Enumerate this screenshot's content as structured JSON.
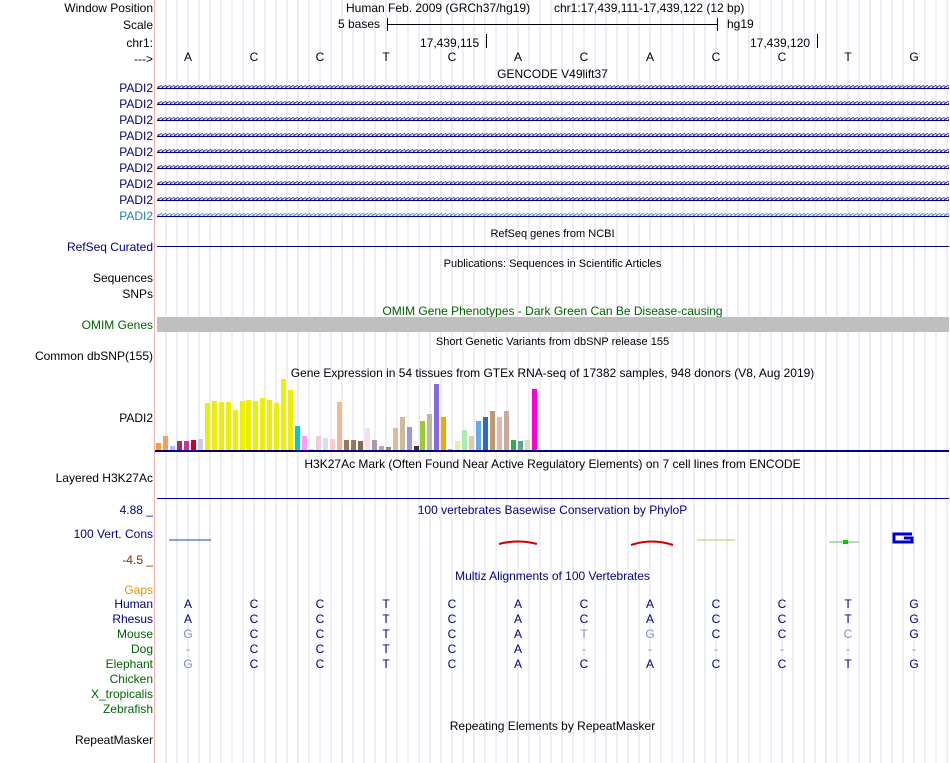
{
  "header": {
    "labels": {
      "window_position": "Window Position",
      "scale": "Scale",
      "chrom": "chr1:",
      "arrow": "--->"
    },
    "assembly": "Human Feb. 2009 (GRCh37/hg19)",
    "position": "chr1:17,439,111-17,439,122 (12 bp)",
    "scale_text": "5 bases",
    "scale_db": "hg19",
    "coord1": "17,439,115",
    "coord2": "17,439,120"
  },
  "sequence": [
    "A",
    "C",
    "C",
    "T",
    "C",
    "A",
    "C",
    "A",
    "C",
    "C",
    "T",
    "G"
  ],
  "gencode": {
    "title": "GENCODE V49lift37",
    "genes": [
      "PADI2",
      "PADI2",
      "PADI2",
      "PADI2",
      "PADI2",
      "PADI2",
      "PADI2",
      "PADI2",
      "PADI2"
    ]
  },
  "refseq": {
    "label": "RefSeq Curated",
    "title": "RefSeq genes from NCBI"
  },
  "publications": {
    "title": "Publications: Sequences in Scientific Articles",
    "label": "Sequences"
  },
  "snps": {
    "label": "SNPs"
  },
  "omim": {
    "title": "OMIM Gene Phenotypes - Dark Green Can Be Disease-causing",
    "label": "OMIM Genes",
    "bar_color": "#bfbfbf"
  },
  "dbsnp": {
    "title": "Short Genetic Variants from dbSNP release 155",
    "label": "Common dbSNP(155)"
  },
  "gtex": {
    "title": "Gene Expression in 54 tissues from GTEx RNA-seq of 17382 samples, 948 donors (V8, Aug 2019)",
    "label": "PADI2",
    "levels": [
      0.1,
      0.2,
      0.05,
      0.12,
      0.12,
      0.14,
      0.15,
      0.65,
      0.68,
      0.67,
      0.66,
      0.55,
      0.68,
      0.7,
      0.68,
      0.72,
      0.7,
      0.65,
      0.98,
      0.84,
      0.33,
      0.2,
      0.02,
      0.2,
      0.16,
      0.15,
      0.67,
      0.14,
      0.14,
      0.12,
      0.3,
      0.14,
      0.05,
      0.04,
      0.3,
      0.46,
      0.32,
      0.05,
      0.4,
      0.5,
      0.92,
      0.46,
      0.02,
      0.12,
      0.28,
      0.2,
      0.4,
      0.46,
      0.54,
      0.46,
      0.54,
      0.14,
      0.12,
      0.14,
      0.85
    ],
    "colors": [
      "#ff9933",
      "#ff9966",
      "#aabbff",
      "#993366",
      "#cc3399",
      "#cc0022",
      "#ccccdd",
      "#eeee00",
      "#eeee00",
      "#eeee00",
      "#eeee00",
      "#eeee00",
      "#eeee00",
      "#eeee00",
      "#eeee00",
      "#eeee00",
      "#eeee00",
      "#eeee00",
      "#eeee00",
      "#eeee00",
      "#00cccc",
      "#ff99ff",
      "#eebbcc",
      "#eeccdd",
      "#ddddee",
      "#ffcccc",
      "#eebb99",
      "#997755",
      "#997755",
      "#886655",
      "#ffdddd",
      "#aa99aa",
      "#cc99cc",
      "#998888",
      "#ddbb99",
      "#ccbb99",
      "#9999dd",
      "#552244",
      "#99cc33",
      "#bbbb99",
      "#8866dd",
      "#eeaa00",
      "#cc99cc",
      "#eeee99",
      "#aaeeaa",
      "#ddccaa",
      "#66aaee",
      "#3366cc",
      "#bb9977",
      "#ddbbaa",
      "#ccaa99",
      "#33aa55",
      "#55aa88",
      "#ddddbb",
      "#ff00dd"
    ]
  },
  "h3k27ac": {
    "title": "H3K27Ac Mark (Often Found Near Active Regulatory Elements) on 7 cell lines from ENCODE",
    "label": "Layered H3K27Ac"
  },
  "phylop": {
    "title": "100 vertebrates Basewise Conservation by PhyloP",
    "label": "100 Vert. Cons",
    "max": "4.88 _",
    "min": "-4.5 _"
  },
  "gaps": {
    "label": "Gaps"
  },
  "multiz": {
    "title": "Multiz Alignments of 100 Vertebrates",
    "species": [
      {
        "name": "Human",
        "bases": [
          "A",
          "C",
          "C",
          "T",
          "C",
          "A",
          "C",
          "A",
          "C",
          "C",
          "T",
          "G"
        ],
        "faded": []
      },
      {
        "name": "Rhesus",
        "bases": [
          "A",
          "C",
          "C",
          "T",
          "C",
          "A",
          "C",
          "A",
          "C",
          "C",
          "T",
          "G"
        ],
        "faded": []
      },
      {
        "name": "Mouse",
        "bases": [
          "G",
          "C",
          "C",
          "T",
          "C",
          "A",
          "T",
          "G",
          "C",
          "C",
          "C",
          "G"
        ],
        "faded": [
          0,
          6,
          7,
          10
        ]
      },
      {
        "name": "Dog",
        "bases": [
          "-",
          "C",
          "C",
          "T",
          "C",
          "A",
          "-",
          "-",
          "-",
          "-",
          "-",
          "-"
        ],
        "faded": [
          0,
          6,
          7,
          8,
          9,
          10,
          11
        ]
      },
      {
        "name": "Elephant",
        "bases": [
          "G",
          "C",
          "C",
          "T",
          "C",
          "A",
          "C",
          "A",
          "C",
          "C",
          "T",
          "G"
        ],
        "faded": [
          0
        ]
      },
      {
        "name": "Chicken",
        "bases": [],
        "faded": []
      },
      {
        "name": "X_tropicalis",
        "bases": [],
        "faded": []
      },
      {
        "name": "Zebrafish",
        "bases": [],
        "faded": []
      }
    ]
  },
  "repeatmasker": {
    "title": "Repeating Elements by RepeatMasker",
    "label": "RepeatMasker"
  }
}
